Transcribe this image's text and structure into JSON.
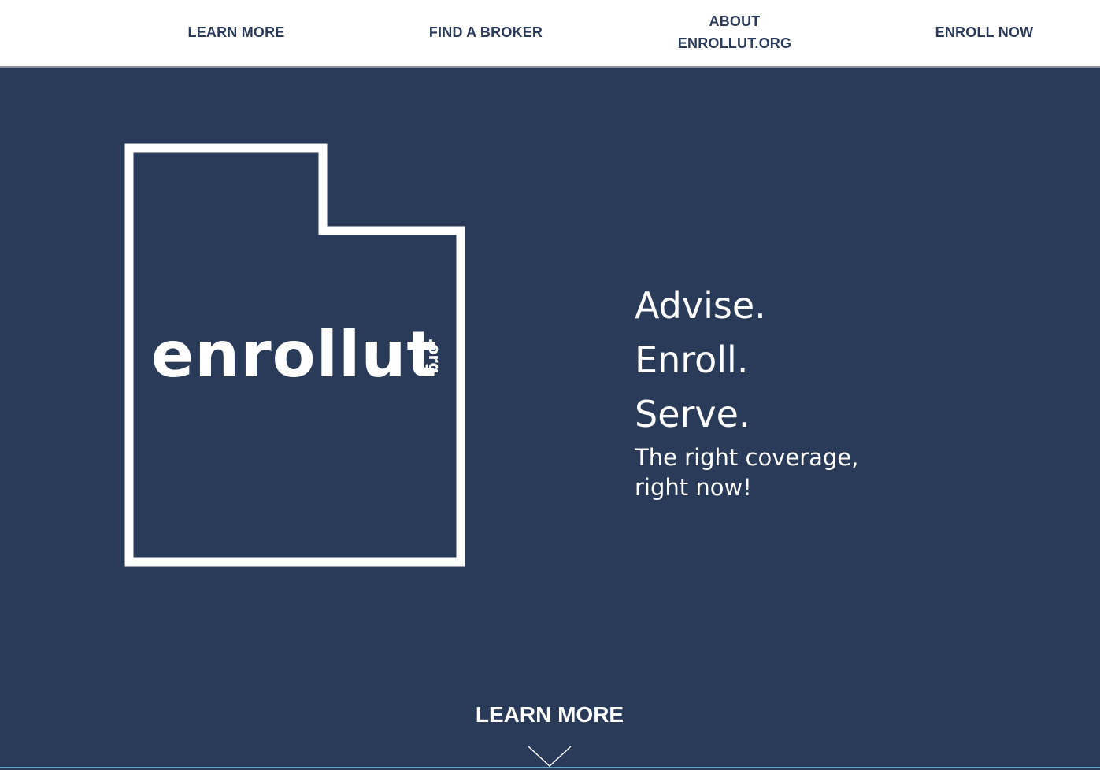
{
  "nav": {
    "items": [
      {
        "label": "LEARN MORE"
      },
      {
        "label": "FIND A BROKER"
      },
      {
        "label_line1": "ABOUT",
        "label_line2": "ENROLLUT.ORG"
      },
      {
        "label": "ENROLL NOW"
      }
    ]
  },
  "hero": {
    "logo_word": "enrollut",
    "logo_tld": ".org",
    "taglines": [
      "Advise.",
      "Enroll.",
      "Serve."
    ],
    "subtitle_line1": "The right coverage,",
    "subtitle_line2": "right now!",
    "cta_label": "LEARN MORE",
    "cta_icon": "chevron-down-icon"
  },
  "colors": {
    "background": "#2a3a59",
    "nav_background": "#ffffff",
    "nav_text": "#2a3a59",
    "hero_text": "#ffffff",
    "accent_line": "#5aa9c9"
  }
}
